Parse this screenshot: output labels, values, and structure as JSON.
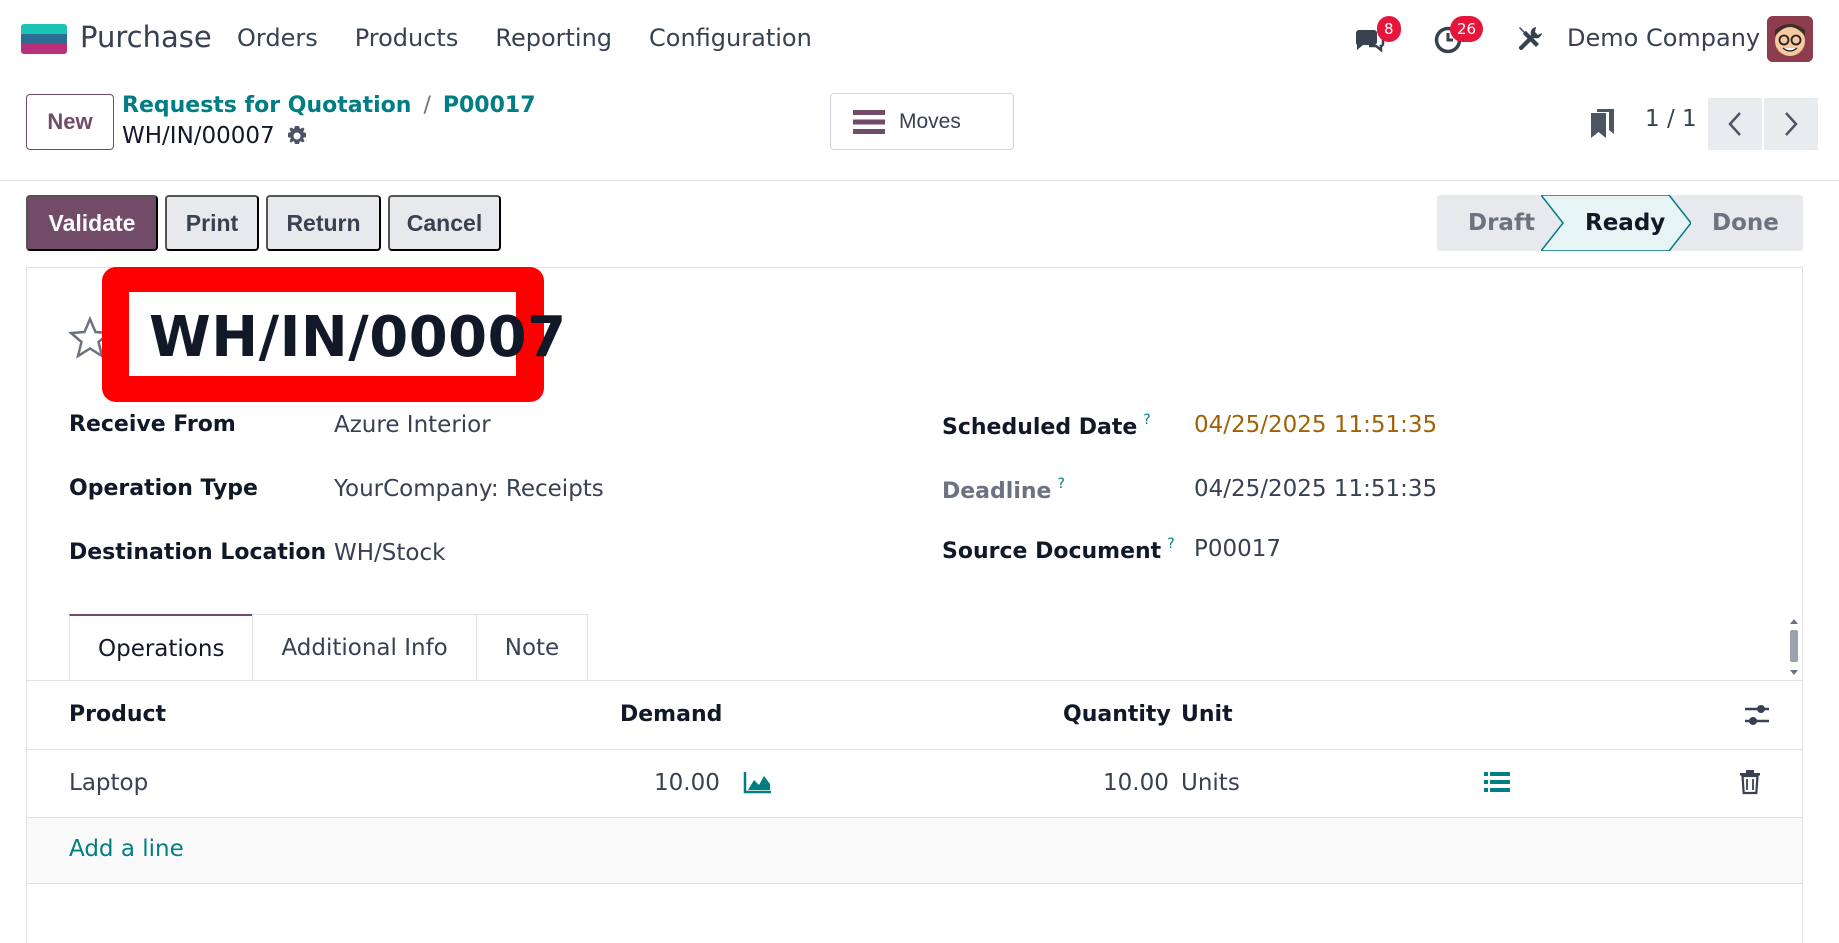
{
  "app": {
    "name": "Purchase"
  },
  "nav": {
    "items": [
      "Orders",
      "Products",
      "Reporting",
      "Configuration"
    ]
  },
  "systray": {
    "messages_count": "8",
    "activity_count": "26",
    "company": "Demo Company"
  },
  "control": {
    "new_label": "New",
    "breadcrumb": [
      "Requests for Quotation",
      "P00017"
    ],
    "breadcrumb_sep": "/",
    "record_name": "WH/IN/00007",
    "moves_label": "Moves",
    "pager": "1 / 1"
  },
  "actions": {
    "validate": "Validate",
    "print": "Print",
    "return": "Return",
    "cancel": "Cancel"
  },
  "stages": {
    "draft": "Draft",
    "ready": "Ready",
    "done": "Done",
    "current": "Ready"
  },
  "record": {
    "title": "WH/IN/00007",
    "fields": {
      "receive_from_label": "Receive From",
      "receive_from": "Azure Interior",
      "operation_type_label": "Operation Type",
      "operation_type": "YourCompany: Receipts",
      "destination_label": "Destination Location",
      "destination": "WH/Stock",
      "scheduled_label": "Scheduled Date",
      "scheduled": "04/25/2025 11:51:35",
      "deadline_label": "Deadline",
      "deadline": "04/25/2025 11:51:35",
      "source_label": "Source Document",
      "source": "P00017",
      "help_mark": "?"
    }
  },
  "tabs": [
    "Operations",
    "Additional Info",
    "Note"
  ],
  "table": {
    "headers": {
      "product": "Product",
      "demand": "Demand",
      "quantity": "Quantity",
      "unit": "Unit"
    },
    "rows": [
      {
        "product": "Laptop",
        "demand": "10.00",
        "quantity": "10.00",
        "unit": "Units"
      }
    ],
    "add_line": "Add a line"
  },
  "colors": {
    "brand": "#714b67",
    "link": "#017e84",
    "highlight": "#ff0000",
    "badge": "#e5163c"
  }
}
